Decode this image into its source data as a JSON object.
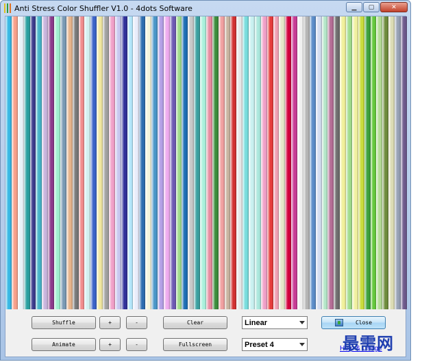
{
  "window": {
    "title": "Anti Stress Color Shuffler V1.0 - 4dots Software"
  },
  "stripes": [
    "#37b8e4",
    "#f7a08a",
    "#e8f2f8",
    "#2aa0a0",
    "#3c3c8c",
    "#46b4c8",
    "#c8b4dc",
    "#8c3c8c",
    "#a0f0d0",
    "#7a9ab4",
    "#e6b48c",
    "#787878",
    "#f08c8c",
    "#d2f0f0",
    "#3c64c8",
    "#f0e6a0",
    "#a0a0a0",
    "#f0a0c8",
    "#c8c8f0",
    "#32329a",
    "#b4e6fa",
    "#e8ecfa",
    "#2e6eb0",
    "#f5f5dc",
    "#4a96c8",
    "#b4a0e6",
    "#eeaaee",
    "#6e5ab4",
    "#a0dc8c",
    "#1e6eb4",
    "#c8c8c8",
    "#3ca0a0",
    "#aaf0dc",
    "#e68ca0",
    "#3c8c3c",
    "#f0a0a0",
    "#c8b4a0",
    "#d23232",
    "#e6e6e6",
    "#78dcdc",
    "#c8f0f0",
    "#aae6dc",
    "#f0a0c8",
    "#e63c3c",
    "#f0a0b4",
    "#e6e6c8",
    "#d2003c",
    "#c83c96",
    "#f0f0f0",
    "#b4b4b4",
    "#5a8cc8",
    "#d2dcf0",
    "#b4e6c8",
    "#b46e96",
    "#6e6e6e",
    "#f0f09a",
    "#a0dc8c",
    "#f0f0a0",
    "#c8dc3c",
    "#3ca03c",
    "#64c83c",
    "#b4dc96",
    "#6e8c3c",
    "#dcdcb4",
    "#96a0b4",
    "#6e5a8c"
  ],
  "controls": {
    "shuffle_label": "Shuffle",
    "plus_label": "+",
    "minus_label": "-",
    "clear_label": "Clear",
    "gradient_select": "Linear",
    "close_label": "Close",
    "animate_label": "Animate",
    "fullscreen_label": "Fullscreen",
    "preset_select": "Preset 4",
    "help_link": "Help & Usage"
  },
  "watermark": "最需网"
}
